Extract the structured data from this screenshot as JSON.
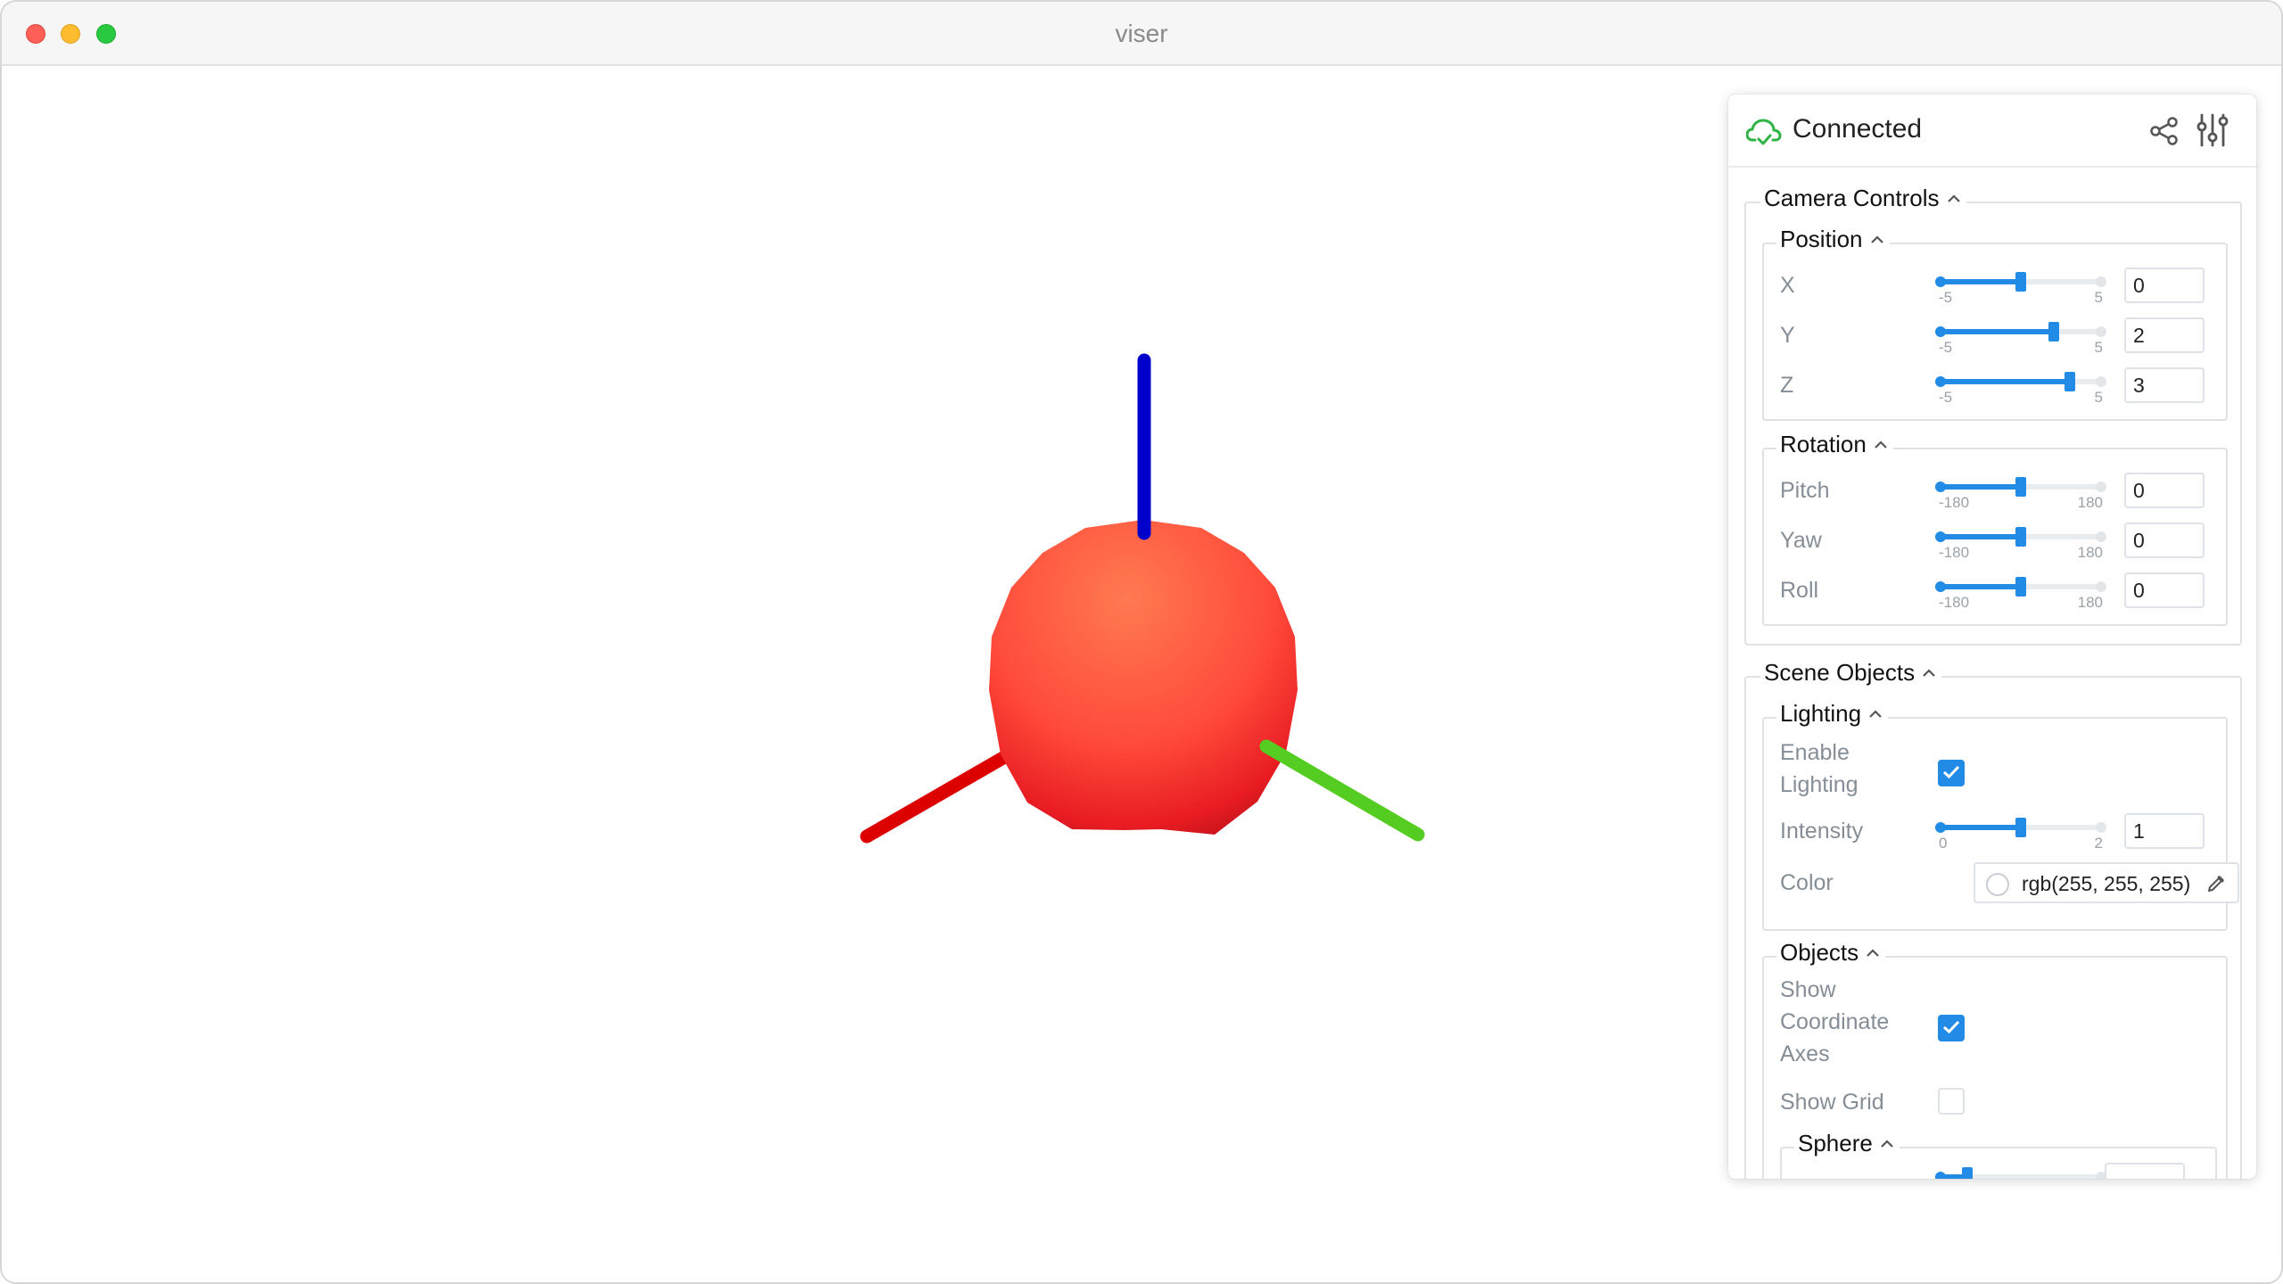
{
  "window": {
    "title": "viser"
  },
  "status": {
    "label": "Connected",
    "color": "#2fb344"
  },
  "panel": {
    "camera": {
      "title": "Camera Controls",
      "position": {
        "title": "Position",
        "rows": [
          {
            "label": "X",
            "min": "-5",
            "max": "5",
            "value": "0",
            "fraction": 0.5
          },
          {
            "label": "Y",
            "min": "-5",
            "max": "5",
            "value": "2",
            "fraction": 0.7
          },
          {
            "label": "Z",
            "min": "-5",
            "max": "5",
            "value": "3",
            "fraction": 0.8
          }
        ]
      },
      "rotation": {
        "title": "Rotation",
        "rows": [
          {
            "label": "Pitch",
            "min": "-180",
            "max": "180",
            "value": "0",
            "fraction": 0.5
          },
          {
            "label": "Yaw",
            "min": "-180",
            "max": "180",
            "value": "0",
            "fraction": 0.5
          },
          {
            "label": "Roll",
            "min": "-180",
            "max": "180",
            "value": "0",
            "fraction": 0.5
          }
        ]
      }
    },
    "scene": {
      "title": "Scene Objects",
      "lighting": {
        "title": "Lighting",
        "enable_label_line1": "Enable",
        "enable_label_line2": "Lighting",
        "enable_checked": true,
        "intensity_label": "Intensity",
        "intensity_min": "0",
        "intensity_max": "2",
        "intensity_value": "1",
        "intensity_fraction": 0.5,
        "color_label": "Color",
        "color_value": "rgb(255, 255, 255)"
      },
      "objects": {
        "title": "Objects",
        "axes_label_line1": "Show",
        "axes_label_line2": "Coordinate",
        "axes_label_line3": "Axes",
        "axes_checked": true,
        "grid_label": "Show Grid",
        "grid_checked": false,
        "sphere": {
          "title": "Sphere"
        }
      }
    }
  },
  "colors": {
    "accent": "#228be6",
    "axis_x": "#dd0000",
    "axis_y": "#55cc22",
    "axis_z": "#0000cc",
    "sphere": "#ff5a45"
  }
}
